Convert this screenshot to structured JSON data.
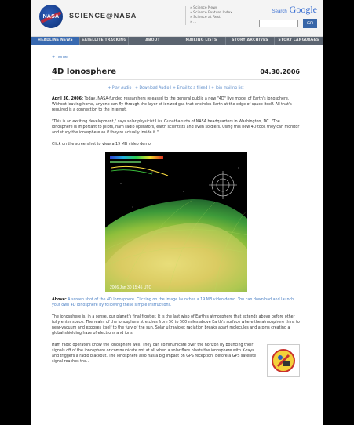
{
  "header": {
    "logo_text": "NASA",
    "site_title": "SCIENCE@NASA",
    "links": [
      "» Science News",
      "» Science Feature Index",
      "» Science at Rest",
      "» ..."
    ],
    "search_brand_a": "Search",
    "search_brand_b": "Google",
    "search_placeholder": "",
    "search_button": "GO"
  },
  "nav": [
    "HEADLINE NEWS",
    "SATELLITE TRACKING",
    "ABOUT",
    "MAILING LISTS",
    "STORY ARCHIVES",
    "STORY LANGUAGES"
  ],
  "breadcrumb": "+ home",
  "article": {
    "title": "4D Ionosphere",
    "date": "04.30.2006",
    "links": "+ Play Audio  |  + Download Audio  |  + Email to a friend  |  + Join mailing list",
    "para1_lead": "April 30, 2006:",
    "para1": " Today, NASA-funded researchers released to the general public a new \"4D\" live model of Earth's ionosphere. Without leaving home, anyone can fly through the layer of ionized gas that encircles Earth at the edge of space itself. All that's required is a connection to the Internet.",
    "para2": "\"This is an exciting development,\" says solar physicist Lika Guhathakurta of NASA headquarters in Washington, DC. \"The ionosphere is important to pilots, ham radio operators, earth scientists and even soldiers. Using this new 4D tool, they can monitor and study the ionosphere as if they're actually inside it.\"",
    "para3": "Click on the screenshot to view a 19 MB video demo:",
    "video_timestamp": "2006 Jan 30 15:45 UTC",
    "caption_lead": "Above:",
    "caption_blue": " A screen shot of the 4D Ionosphere. Clicking on the image launches a 19 MB video demo. You can download and launch your own 4D Ionosphere by following these simple instructions.",
    "para4": "The ionosphere is, in a sense, our planet's final frontier. It is the last wisp of Earth's atmosphere that extends above before other fully enter space. The realm of the ionosphere stretches from 50 to 500 miles above Earth's surface where the atmosphere thins to near-vacuum and exposes itself to the fury of the sun. Solar ultraviolet radiation breaks apart molecules and atoms creating a global-shielding haze of electrons and ions.",
    "para5": "Ham radio operators know the ionosphere well. They can communicate over the horizon by bouncing their signals off of the ionosphere or communicate not at all when a solar flare blasts the ionosphere with X-rays and triggers a radio blackout. The ionosphere also has a big impact on GPS reception. Before a GPS satellite signal reaches the..."
  },
  "colors": {
    "nav_bg": "#5b6470",
    "nav_active": "#3869b0",
    "link": "#4a7fc4"
  }
}
